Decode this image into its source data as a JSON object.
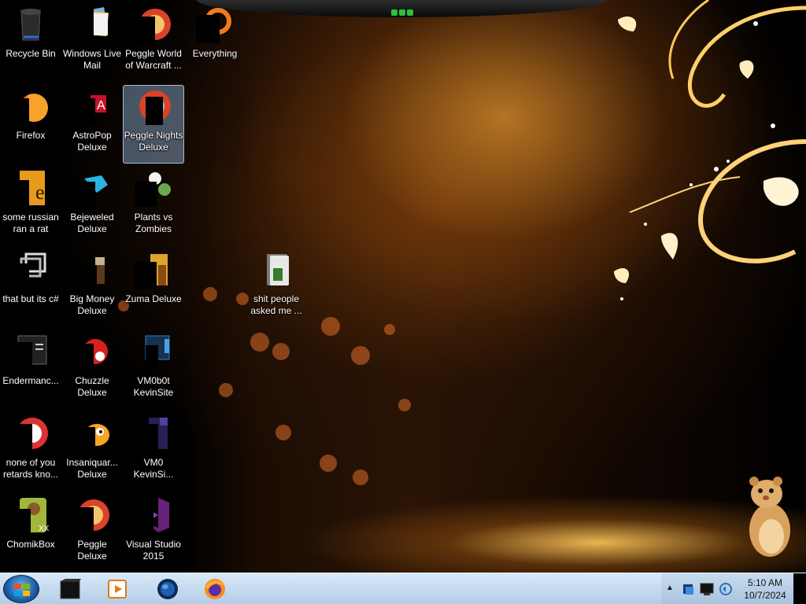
{
  "desktop": {
    "icons": [
      {
        "label": "Recycle Bin",
        "icon": "recycle-bin-icon"
      },
      {
        "label": "Windows Live\nMail",
        "icon": "mail-icon"
      },
      {
        "label": "Peggle World\nof Warcraft ...",
        "icon": "peggle-icon"
      },
      {
        "label": "Everything",
        "icon": "search-icon"
      },
      {
        "label": "Firefox",
        "icon": "firefox-icon"
      },
      {
        "label": "AstroPop\nDeluxe",
        "icon": "game-icon"
      },
      {
        "label": "Peggle Nights\nDeluxe",
        "icon": "peggle-icon"
      },
      {
        "label": "some russian\nran a rat",
        "icon": "document-icon"
      },
      {
        "label": "Bejeweled\nDeluxe",
        "icon": "gem-icon"
      },
      {
        "label": "Plants vs\nZombies",
        "icon": "plant-icon"
      },
      {
        "label": "that but its c#",
        "icon": "shortcut-icon"
      },
      {
        "label": "Big Money\nDeluxe",
        "icon": "money-icon"
      },
      {
        "label": "Zuma Deluxe",
        "icon": "zuma-icon"
      },
      {
        "label": "shit people\nasked me ...",
        "icon": "folder-icon"
      },
      {
        "label": "Endermanc...",
        "icon": "program-icon"
      },
      {
        "label": "Chuzzle\nDeluxe",
        "icon": "chuzzle-icon"
      },
      {
        "label": "VM0b0t\nKevinSite",
        "icon": "vm-icon"
      },
      {
        "label": "none of you\nretards kno...",
        "icon": "browser-icon"
      },
      {
        "label": "Insaniquar...\nDeluxe",
        "icon": "fish-icon"
      },
      {
        "label": "VM0\nKevinSi...",
        "icon": "file-icon"
      },
      {
        "label": "ChomikBox",
        "icon": "hamster-icon"
      },
      {
        "label": "Peggle Deluxe",
        "icon": "peggle-icon"
      },
      {
        "label": "Visual Studio\n2015",
        "icon": "visual-studio-icon"
      }
    ],
    "selected_icon": "Peggle Nights\nDeluxe"
  },
  "taskbar": {
    "pinned": [
      {
        "name": "task-item-unknown-app",
        "icon": "black-box-icon"
      },
      {
        "name": "task-item-media-player",
        "icon": "media-player-icon"
      },
      {
        "name": "task-item-globe-app",
        "icon": "globe-icon"
      },
      {
        "name": "task-item-firefox",
        "icon": "firefox-icon"
      }
    ],
    "tray": {
      "show_hidden_arrow": "▲",
      "time": "5:10 AM",
      "date": "10/7/2024"
    }
  },
  "colors": {
    "taskbar_top": "#d8e9f8",
    "taskbar_bottom": "#b4cde6",
    "selection": "#96b9dc",
    "wallpaper_glow": "#e89a3a"
  }
}
